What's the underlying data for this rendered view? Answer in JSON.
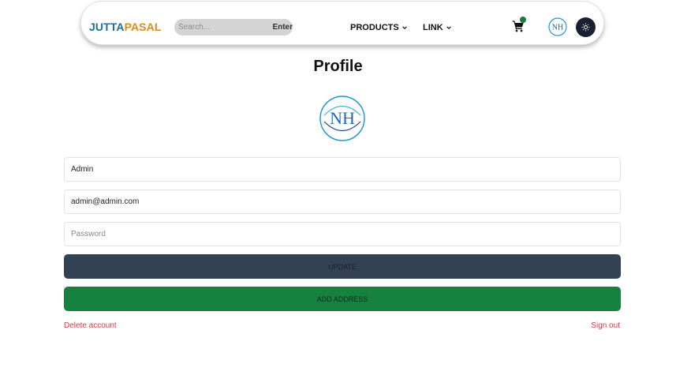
{
  "brand": {
    "part1": "JUTTA",
    "part2": "PASAL"
  },
  "search": {
    "placeholder": "Search...",
    "button_label": "Enter"
  },
  "nav": {
    "products_label": "PRODUCTS",
    "link_label": "LINK"
  },
  "avatar": {
    "initials": "NH"
  },
  "page": {
    "title": "Profile"
  },
  "form": {
    "name_value": "Admin",
    "email_value": "admin@admin.com",
    "password_placeholder": "Password",
    "update_label": "UPDATE",
    "add_address_label": "ADD ADDRESS",
    "delete_label": "Delete account",
    "signout_label": "Sign out"
  },
  "colors": {
    "brand_blue": "#1f6f98",
    "brand_orange": "#e08a1a",
    "update_bg": "#334155",
    "address_bg": "#178240",
    "danger": "#d23c3c"
  }
}
